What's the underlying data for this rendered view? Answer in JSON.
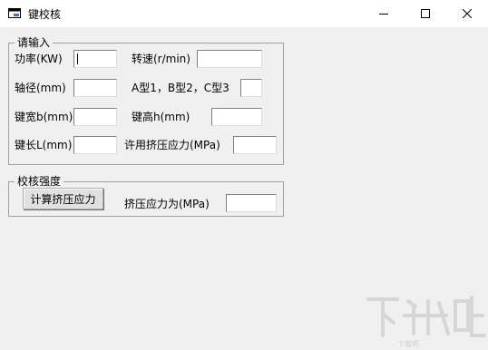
{
  "window": {
    "title": "键校核"
  },
  "input_group": {
    "legend": "请输入",
    "fields": {
      "power_label": "功率(KW)",
      "speed_label": "转速(r/min)",
      "shaft_label": "轴径(mm)",
      "type_label": "A型1，B型2，C型3",
      "width_label": "键宽b(mm)",
      "height_label": "键高h(mm)",
      "length_label": "键长L(mm)",
      "allow_label": "许用挤压应力(MPa)"
    }
  },
  "check_group": {
    "legend": "校核强度",
    "button_label": "计算挤压应力",
    "result_label": "挤压应力为(MPa)"
  },
  "watermark": {
    "text": "下载吧"
  }
}
